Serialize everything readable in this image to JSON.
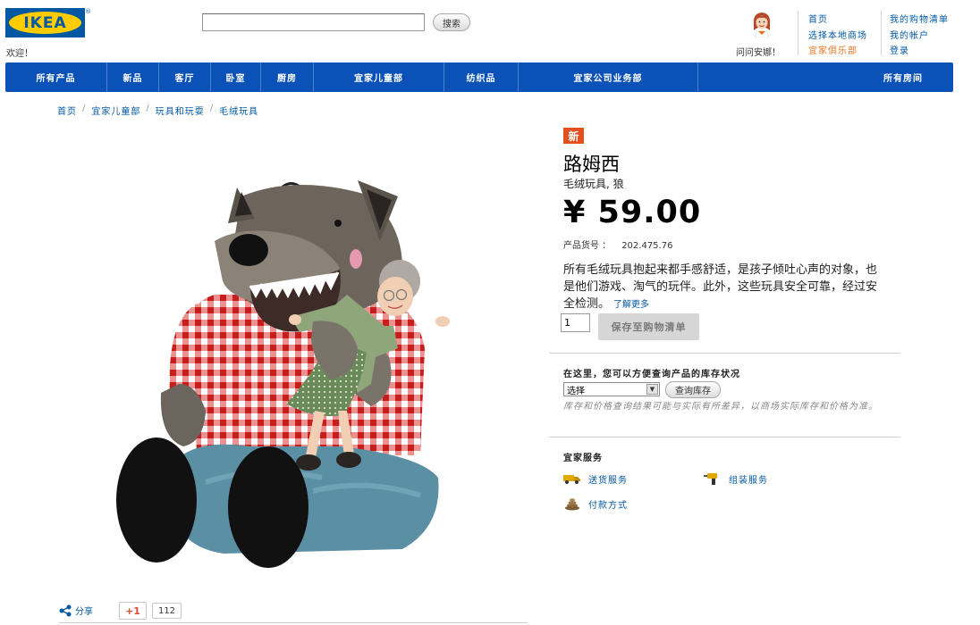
{
  "header": {
    "logo_text": "IKEA",
    "logo_reg": "®",
    "welcome": "欢迎！",
    "search_button": "搜索",
    "search_value": "",
    "ask_anna": "问问安娜！",
    "links_col1": [
      "首页",
      "选择本地商场",
      "宜家俱乐部"
    ],
    "links_col2": [
      "我的购物清单",
      "我的帐户",
      "登录"
    ]
  },
  "nav": {
    "items": [
      "所有产品",
      "新品",
      "客厅",
      "卧室",
      "厨房",
      "宜家儿童部",
      "纺织品",
      "宜家公司业务部",
      "所有房间"
    ]
  },
  "breadcrumb": [
    "首页",
    "宜家儿童部",
    "玩具和玩耍",
    "毛绒玩具"
  ],
  "product": {
    "badge": "新",
    "name": "路姆西",
    "type": "毛绒玩具, 狼",
    "price": "¥ 59.00",
    "article_label": "产品货号 ：",
    "article_number": "202.475.76",
    "description": "所有毛绒玩具抱起来都手感舒适，是孩子倾吐心声的对象，也是他们游戏、淘气的玩伴。此外，这些玩具安全可靠，经过安全检测。",
    "more_link": "了解更多",
    "quantity": "1",
    "save_button": "保存至购物清单"
  },
  "stock": {
    "title": "在这里，您可以方便查询产品的库存状况",
    "select_value": "选择",
    "button": "查询库存",
    "note": "库存和价格查询结果可能与实际有所差异，以商场实际库存和价格为准。"
  },
  "services": {
    "title": "宜家服务",
    "delivery": "送货服务",
    "assembly": "组装服务",
    "payment": "付款方式"
  },
  "share": {
    "label": "分享",
    "gplus": "+1",
    "count": "112"
  }
}
